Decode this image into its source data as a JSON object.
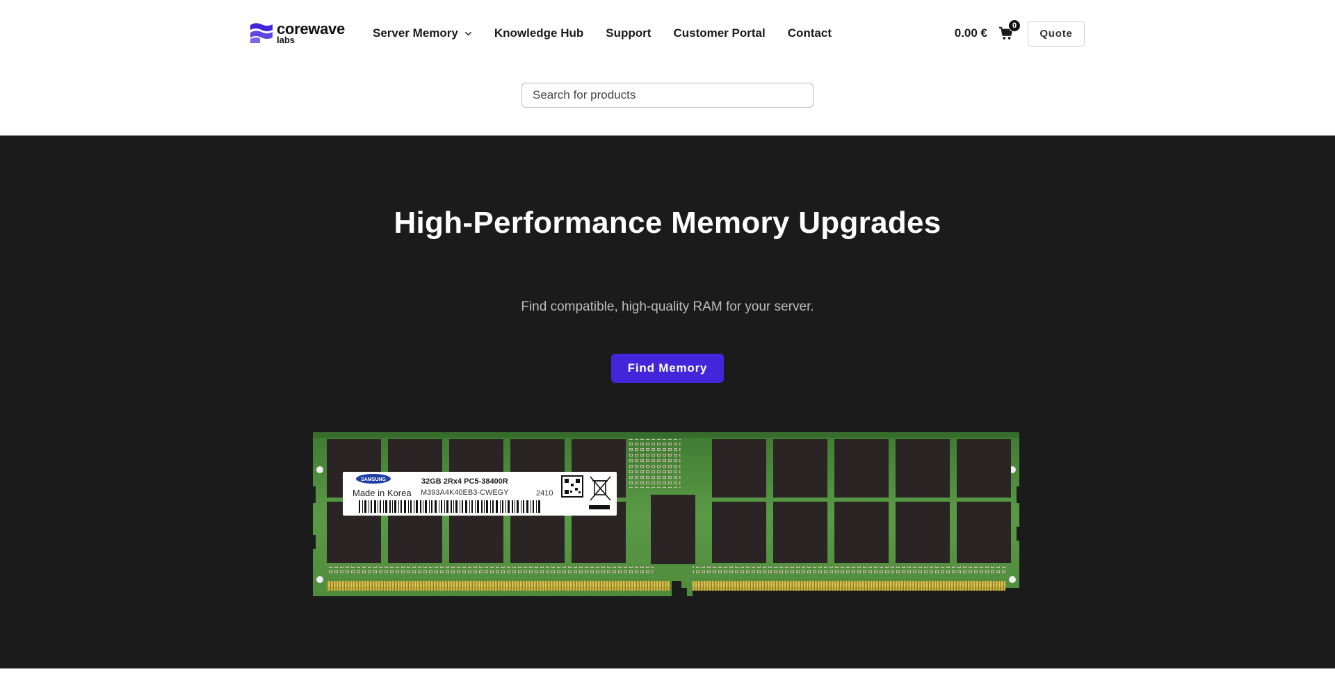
{
  "brand": {
    "name_line1": "corewave",
    "name_line2": "labs",
    "accent_color": "#4326d9"
  },
  "nav": {
    "items": [
      {
        "label": "Server Memory",
        "has_dropdown": true
      },
      {
        "label": "Knowledge Hub"
      },
      {
        "label": "Support"
      },
      {
        "label": "Customer Portal"
      },
      {
        "label": "Contact"
      }
    ]
  },
  "cart": {
    "total": "0.00 €",
    "count": "0",
    "icon": "shopping-cart-icon"
  },
  "quote_label": "Quote",
  "search": {
    "placeholder": "Search for products",
    "value": ""
  },
  "hero": {
    "title": "High-Performance Memory Upgrades",
    "subtitle": "Find compatible, high-quality RAM for your server.",
    "cta_label": "Find Memory",
    "background_color": "#1b1b1b"
  },
  "product_image": {
    "label_brand": "SAMSUNG",
    "label_origin": "Made in Korea",
    "label_spec": "32GB 2Rx4 PC5-38400R",
    "label_part": "M393A4K40EB3-CWEGY",
    "label_date": "2410"
  }
}
